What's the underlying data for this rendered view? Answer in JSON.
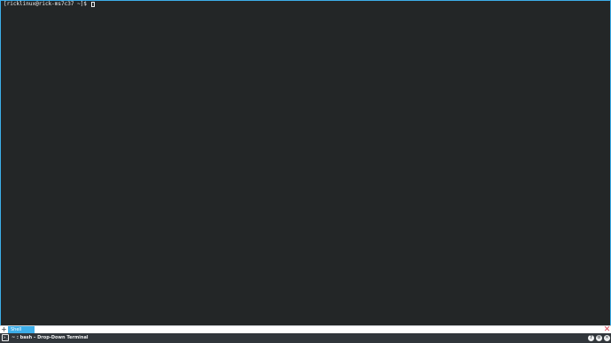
{
  "terminal": {
    "prompt": "[ricklinux@rick-ms7c37 ~]$ "
  },
  "tabbar": {
    "add_icon": "+",
    "tabs": [
      {
        "label": "Shell"
      }
    ],
    "close_icon": "✕"
  },
  "titlebar": {
    "icon": "terminal-icon",
    "title": "~ : bash – Drop-Down Terminal",
    "buttons": [
      "help",
      "settings",
      "close"
    ]
  },
  "colors": {
    "accent": "#3daee9",
    "terminal_bg": "#232627",
    "titlebar_bg": "#31363b",
    "close_red": "#da4453"
  }
}
